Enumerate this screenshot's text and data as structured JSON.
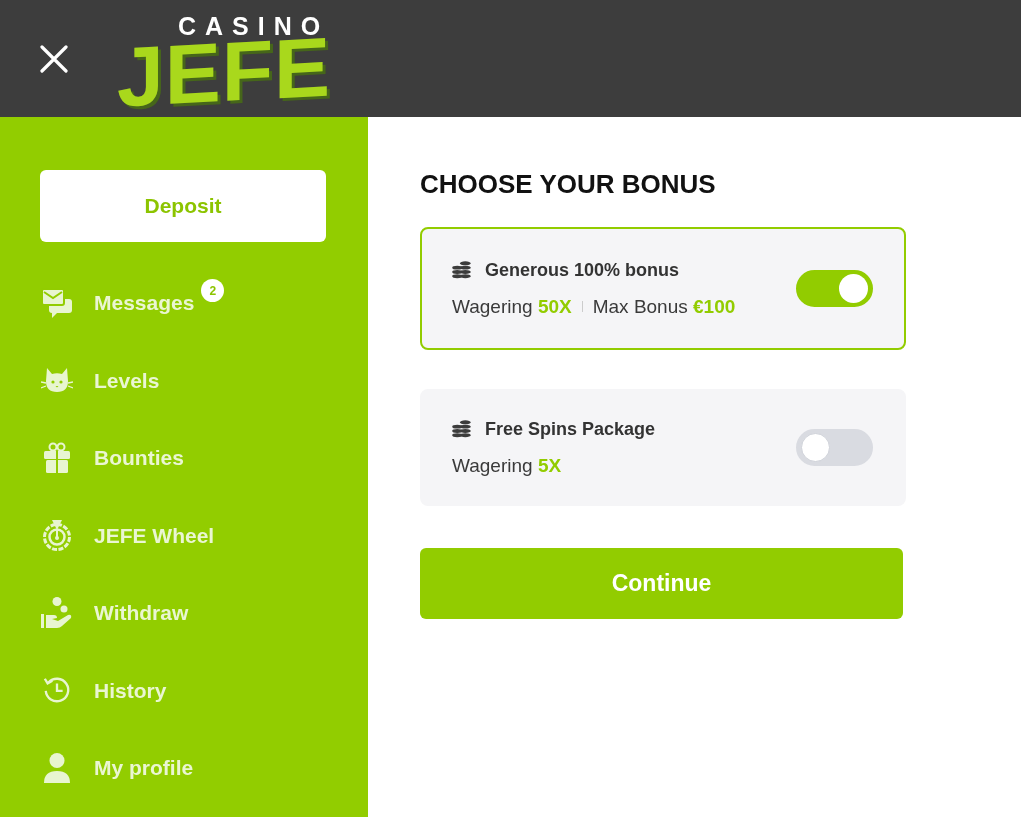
{
  "header": {
    "logo": {
      "small_text": "CASINO",
      "large_text": "JEFE"
    }
  },
  "sidebar": {
    "deposit_button": "Deposit",
    "items": [
      {
        "label": "Messages",
        "badge": "2"
      },
      {
        "label": "Levels"
      },
      {
        "label": "Bounties"
      },
      {
        "label": "JEFE Wheel"
      },
      {
        "label": "Withdraw"
      },
      {
        "label": "History"
      },
      {
        "label": "My profile"
      }
    ]
  },
  "main": {
    "title": "CHOOSE YOUR BONUS",
    "options": [
      {
        "title": "Generous 100% bonus",
        "details": [
          "Wagering **50X**",
          "Max Bonus **€100**"
        ],
        "selected": true
      },
      {
        "title": "Free Spins Package",
        "details": [
          "Wagering **5X**"
        ],
        "selected": false
      }
    ],
    "continue_button": "Continue"
  }
}
